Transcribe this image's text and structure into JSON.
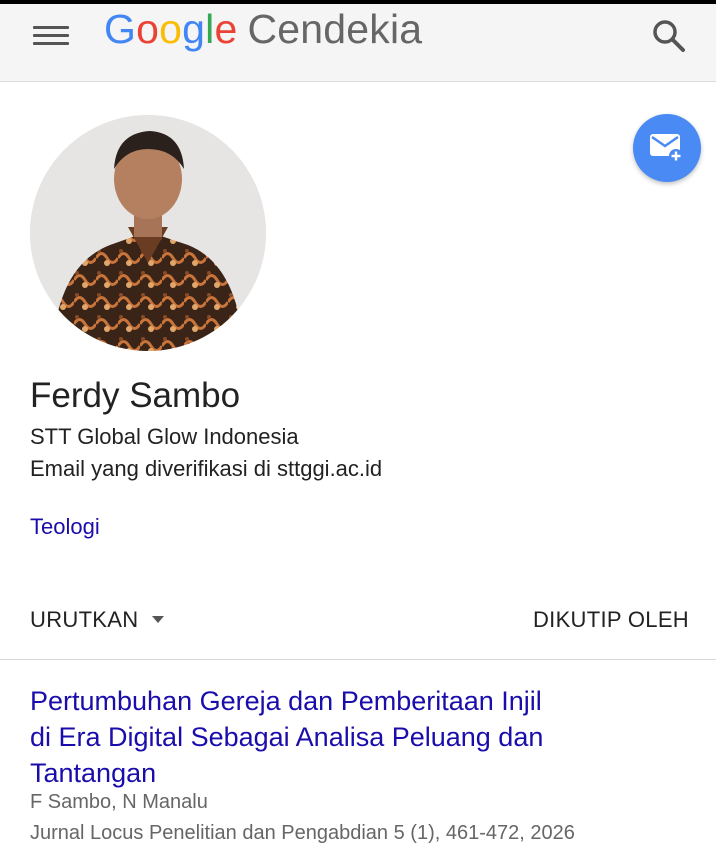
{
  "header": {
    "logo_letters": [
      "G",
      "o",
      "o",
      "g",
      "l",
      "e"
    ],
    "product_name": "Cendekia"
  },
  "profile": {
    "name": "Ferdy Sambo",
    "affiliation": "STT Global Glow Indonesia",
    "email_verified": "Email yang diverifikasi di sttggi.ac.id",
    "interest": "Teologi"
  },
  "sort_bar": {
    "sort_label": "URUTKAN",
    "cited_by_label": "DIKUTIP OLEH"
  },
  "publications": [
    {
      "title": "Pertumbuhan Gereja dan Pemberitaan Injil di Era Digital Sebagai Analisa Peluang dan Tantangan",
      "authors": "F Sambo, N Manalu",
      "venue": "Jurnal Locus Penelitian dan Pengabdian 5 (1), 461-472, 2026"
    }
  ],
  "colors": {
    "link": "#1a0dab",
    "fab": "#4a8af4",
    "google_blue": "#4285f4",
    "google_red": "#ea4335",
    "google_yellow": "#fbbc05",
    "google_green": "#34a853"
  },
  "icons": {
    "menu": "menu-icon",
    "search": "search-icon",
    "follow": "mail-plus-icon"
  }
}
